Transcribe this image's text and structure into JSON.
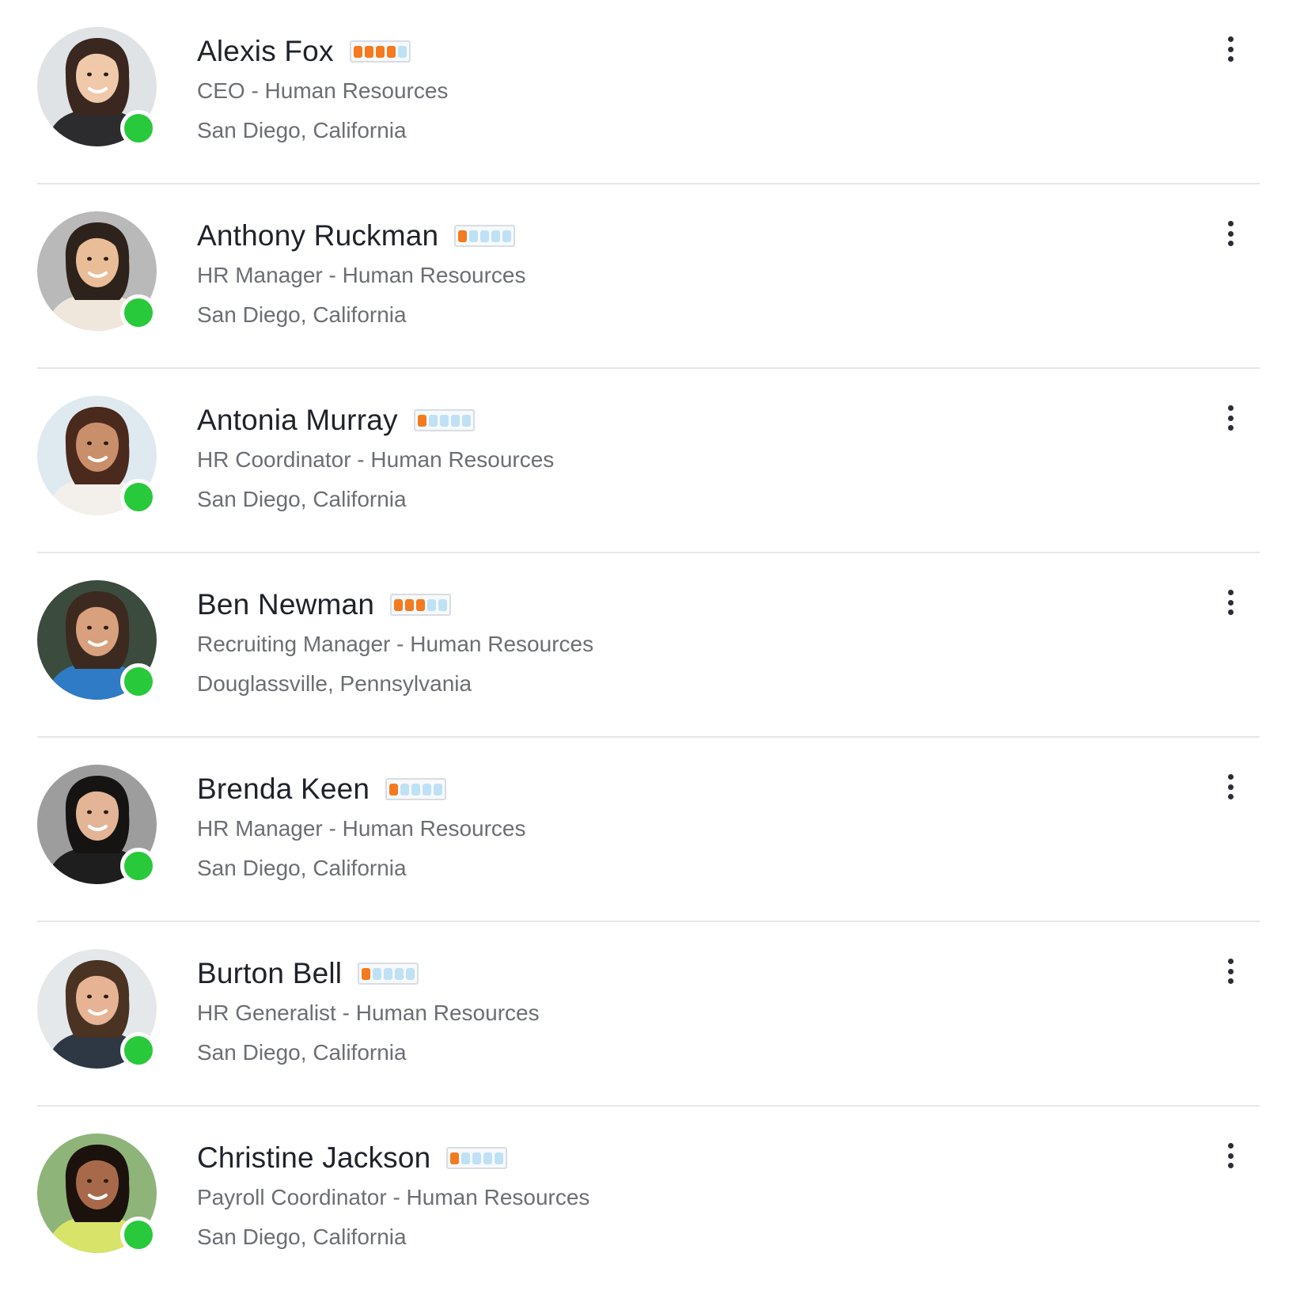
{
  "people": [
    {
      "name": "Alexis Fox",
      "rating": 4,
      "rating_max": 5,
      "title": "CEO - Human Resources",
      "location": "San Diego, California",
      "status": "online",
      "avatar": {
        "bg": "#dfe3e6",
        "skin": "#f0c9ab",
        "hair": "#3a2720",
        "shirt": "#2c2c2e"
      }
    },
    {
      "name": "Anthony Ruckman",
      "rating": 1,
      "rating_max": 5,
      "title": "HR Manager - Human Resources",
      "location": "San Diego, California",
      "status": "online",
      "avatar": {
        "bg": "#b9b9b9",
        "skin": "#e9bd98",
        "hair": "#2d221c",
        "shirt": "#efe7dc"
      }
    },
    {
      "name": "Antonia Murray",
      "rating": 1,
      "rating_max": 5,
      "title": "HR Coordinator - Human Resources",
      "location": "San Diego, California",
      "status": "online",
      "avatar": {
        "bg": "#dfe9f0",
        "skin": "#c98f6a",
        "hair": "#4a2a1d",
        "shirt": "#f3f0ec"
      }
    },
    {
      "name": "Ben Newman",
      "rating": 3,
      "rating_max": 5,
      "title": "Recruiting Manager - Human Resources",
      "location": "Douglassville, Pennsylvania",
      "status": "online",
      "avatar": {
        "bg": "#3b4b3d",
        "skin": "#d8a07c",
        "hair": "#3c2a20",
        "shirt": "#2f7bc5"
      }
    },
    {
      "name": "Brenda Keen",
      "rating": 1,
      "rating_max": 5,
      "title": "HR Manager - Human Resources",
      "location": "San Diego, California",
      "status": "online",
      "avatar": {
        "bg": "#9d9d9d",
        "skin": "#e3b596",
        "hair": "#161412",
        "shirt": "#1e1e1e"
      }
    },
    {
      "name": "Burton Bell",
      "rating": 1,
      "rating_max": 5,
      "title": "HR Generalist - Human Resources",
      "location": "San Diego, California",
      "status": "online",
      "avatar": {
        "bg": "#e5e8ea",
        "skin": "#e6b494",
        "hair": "#4a3322",
        "shirt": "#2e3845"
      }
    },
    {
      "name": "Christine Jackson",
      "rating": 1,
      "rating_max": 5,
      "title": "Payroll Coordinator - Human Resources",
      "location": "San Diego, California",
      "status": "online",
      "avatar": {
        "bg": "#8fb47a",
        "skin": "#a8694a",
        "hair": "#1b120d",
        "shirt": "#d8e36a"
      }
    }
  ],
  "colors": {
    "online": "#28c93a",
    "rating_on": "#f47a1f",
    "rating_off": "#bfe1f6",
    "divider": "#e6e6e6"
  },
  "icons": {
    "menu": "more-vertical-icon",
    "status": "online-status-icon"
  }
}
